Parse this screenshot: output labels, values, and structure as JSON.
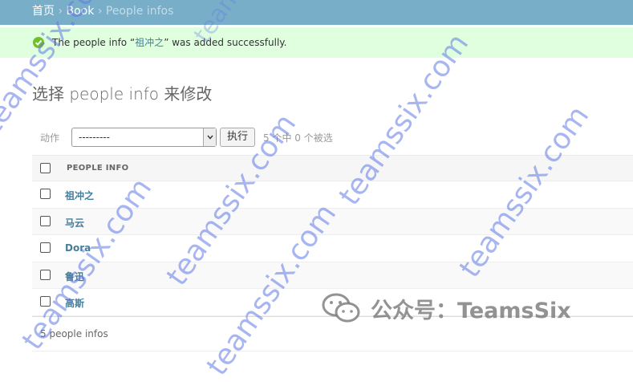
{
  "breadcrumbs": {
    "home": "首页",
    "sep1": "›",
    "app": "Book",
    "sep2": "›",
    "current": "People infos"
  },
  "message": {
    "prefix": "The people info “",
    "link": "祖冲之",
    "suffix": "” was added successfully.",
    "icon": "success-check-icon",
    "color": "#70bf2b"
  },
  "page": {
    "title": "选择 people info 来修改"
  },
  "actions": {
    "label": "动作",
    "selected_value": "---------",
    "go_label": "执行",
    "counter": "5 个中 0 个被选"
  },
  "table": {
    "column_header": "PEOPLE INFO",
    "rows": [
      {
        "name": "祖冲之"
      },
      {
        "name": "马云"
      },
      {
        "name": "Dora"
      },
      {
        "name": "鲁迅"
      },
      {
        "name": "高斯"
      }
    ]
  },
  "paginator": {
    "text": "5 people infos"
  },
  "watermark": {
    "text": "teamssix.com",
    "wechat": "公众号：TeamsSix",
    "wechat_icon": "wechat-icon"
  },
  "colors": {
    "header": "#79aec8",
    "link": "#447e9b",
    "success_bg": "#dfffdf"
  }
}
